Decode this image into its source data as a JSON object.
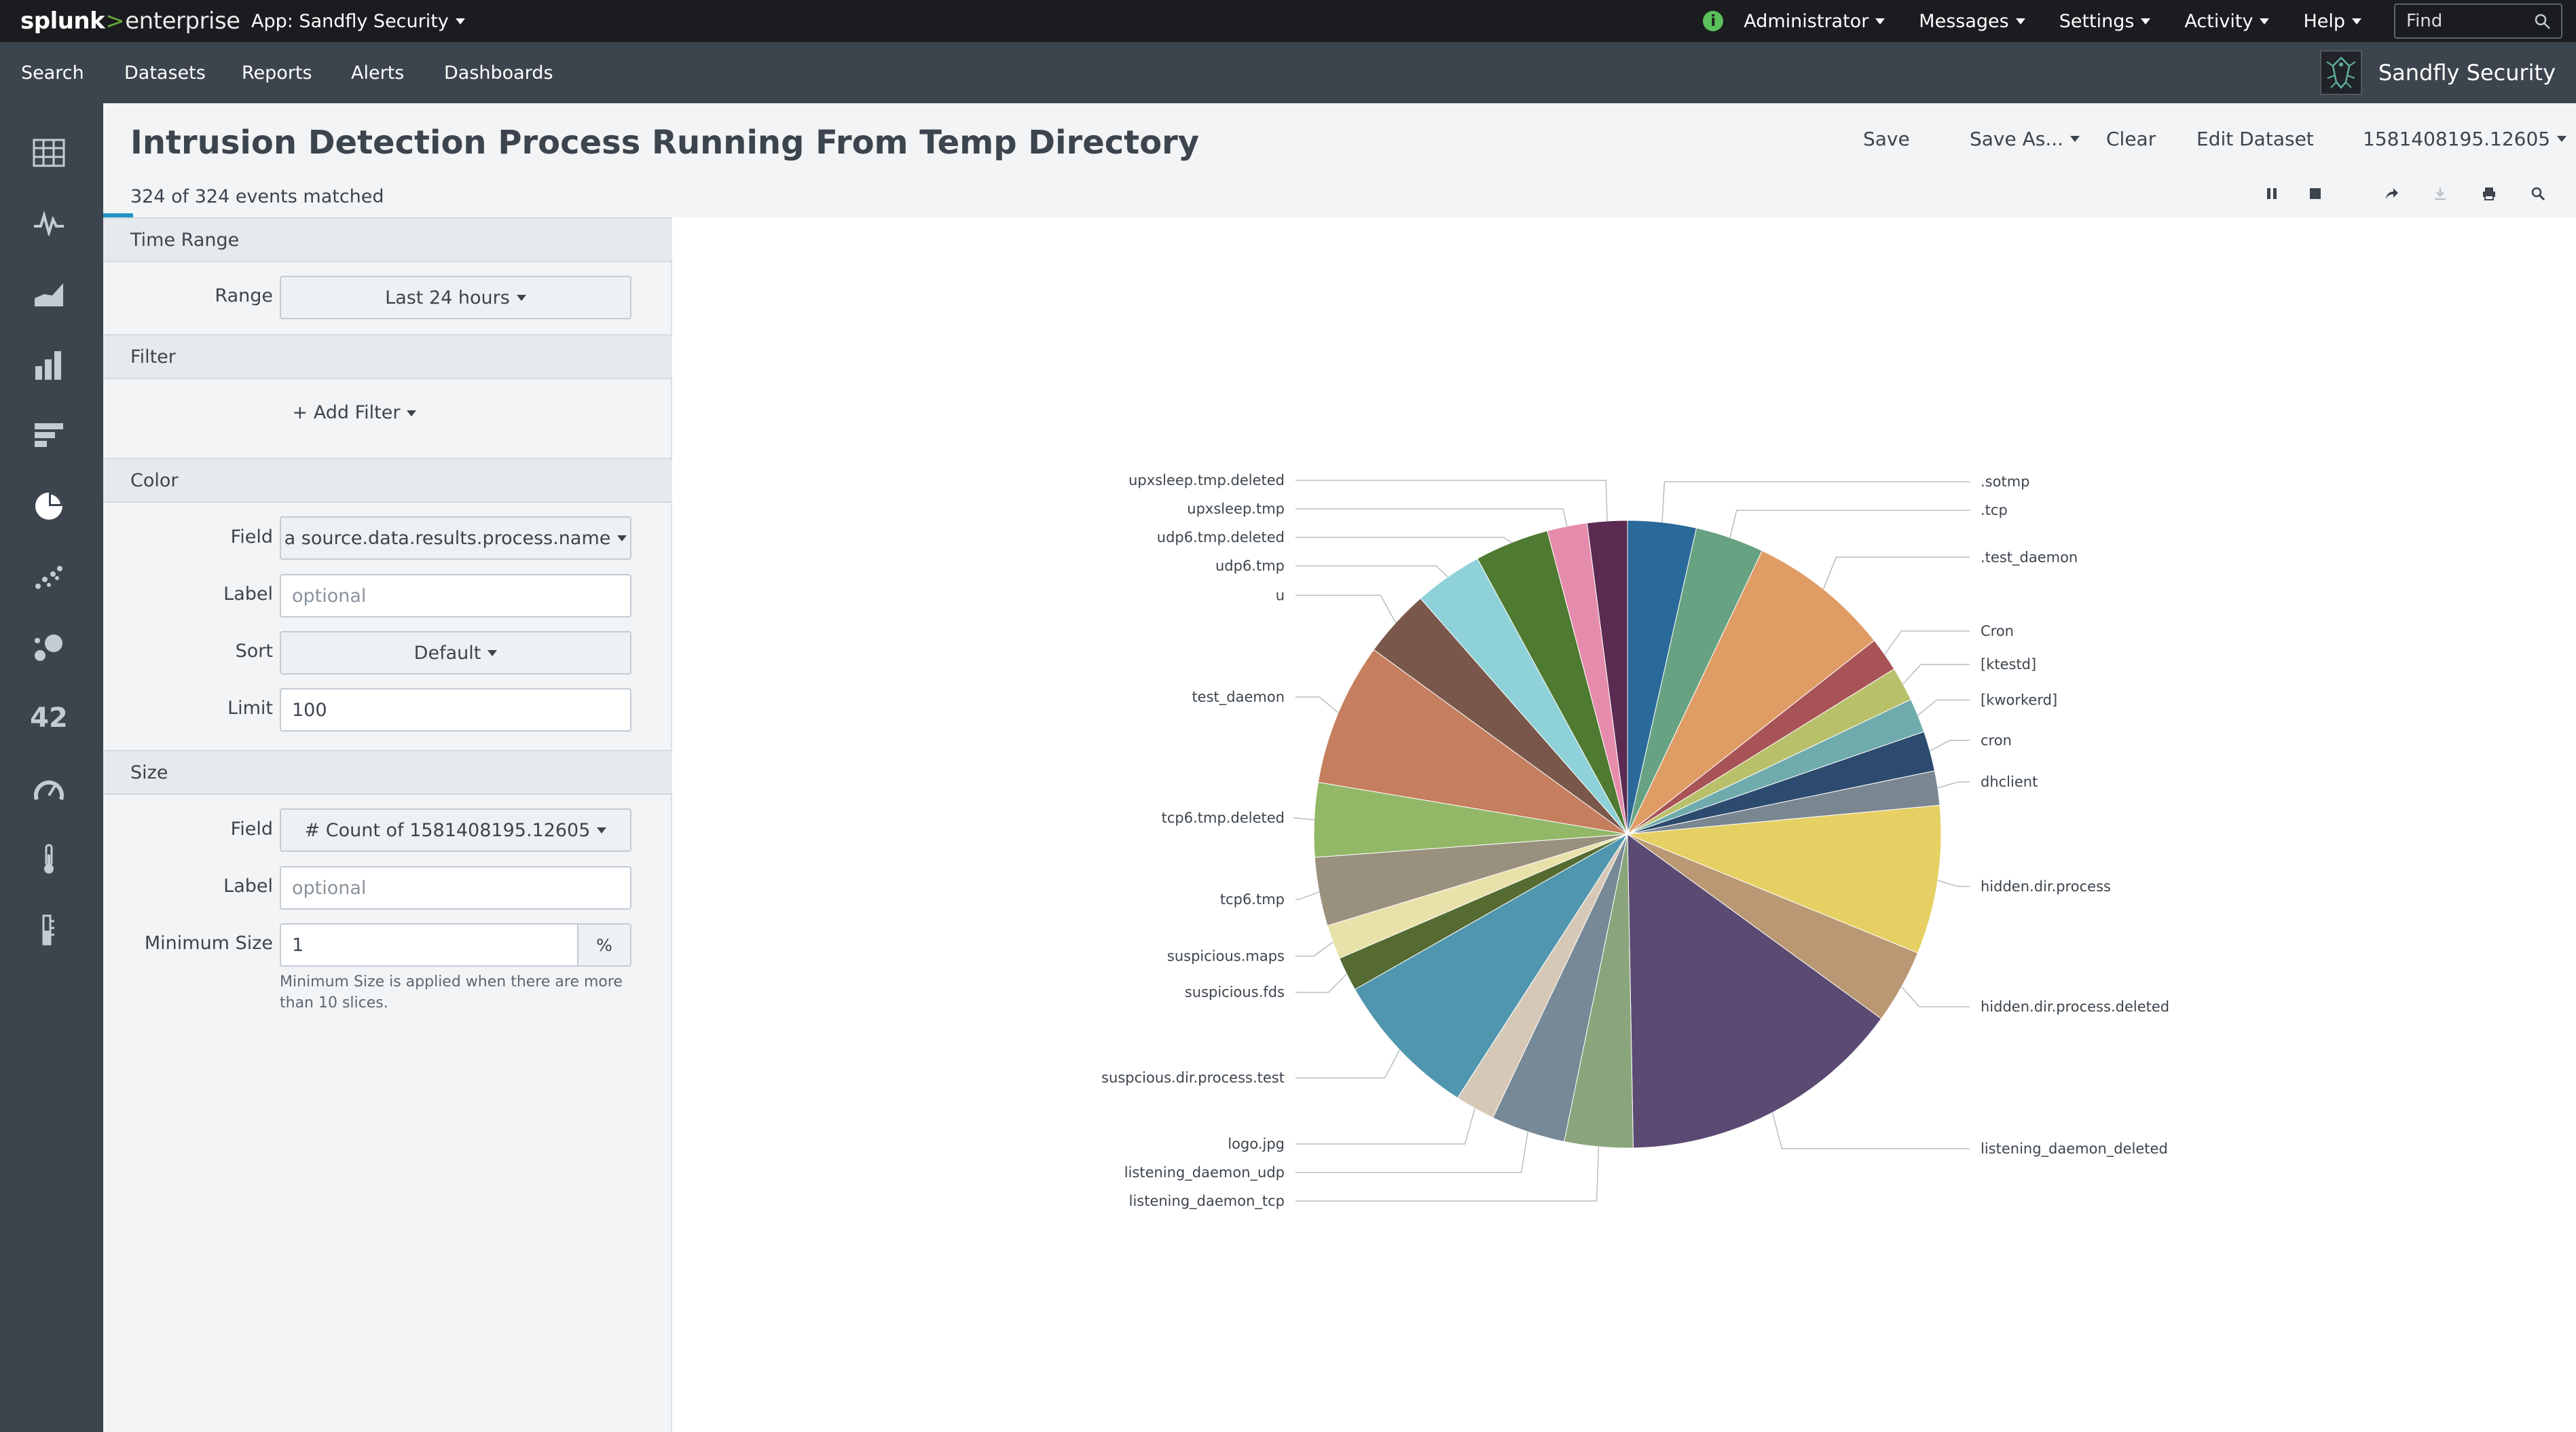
{
  "topbar": {
    "logo_splunk": "splunk",
    "logo_gt": ">",
    "logo_enterprise": "enterprise",
    "app_menu": "App: Sandfly Security",
    "info_icon": "i",
    "user_menu": "Administrator",
    "messages_menu": "Messages",
    "settings_menu": "Settings",
    "activity_menu": "Activity",
    "help_menu": "Help",
    "find_placeholder": "Find"
  },
  "nav": {
    "items": [
      {
        "label": "Search"
      },
      {
        "label": "Datasets"
      },
      {
        "label": "Reports"
      },
      {
        "label": "Alerts"
      },
      {
        "label": "Dashboards"
      }
    ],
    "app_name": "Sandfly Security"
  },
  "header": {
    "title": "Intrusion Detection Process Running From Temp Directory",
    "events_matched": "324 of 324 events matched",
    "save": "Save",
    "save_as": "Save As...",
    "clear": "Clear",
    "edit_dataset": "Edit Dataset",
    "job_id": "1581408195.12605"
  },
  "panel": {
    "time_range": {
      "heading": "Time Range",
      "range_label": "Range",
      "range_value": "Last 24 hours"
    },
    "filter": {
      "heading": "Filter",
      "add_filter": "+ Add Filter"
    },
    "color": {
      "heading": "Color",
      "field_label": "Field",
      "field_value": "a source.data.results.process.name",
      "label_label": "Label",
      "label_placeholder": "optional",
      "sort_label": "Sort",
      "sort_value": "Default",
      "limit_label": "Limit",
      "limit_value": "100"
    },
    "size": {
      "heading": "Size",
      "field_label": "Field",
      "field_value": "# Count of 1581408195.12605",
      "label_label": "Label",
      "label_placeholder": "optional",
      "min_size_label": "Minimum Size",
      "min_size_value": "1",
      "min_size_unit": "%",
      "help_line1": "Minimum Size is applied when there are more",
      "help_line2": "than 10 slices."
    }
  },
  "chart_data": {
    "type": "pie",
    "slices": [
      {
        "label": ".sotmp",
        "value": 12,
        "color": "#2a6a9a"
      },
      {
        "label": ".tcp",
        "value": 12,
        "color": "#67a282"
      },
      {
        "label": ".test_daemon",
        "value": 25,
        "color": "#e09c65"
      },
      {
        "label": "Cron",
        "value": 6,
        "color": "#a85457"
      },
      {
        "label": "[ktestd]",
        "value": 6,
        "color": "#b9c06a"
      },
      {
        "label": "[kworkerd]",
        "value": 6,
        "color": "#6fabac"
      },
      {
        "label": "cron",
        "value": 7,
        "color": "#2d4b6e"
      },
      {
        "label": "dhclient",
        "value": 6,
        "color": "#7a8791"
      },
      {
        "label": "hidden.dir.process",
        "value": 26,
        "color": "#e6d063"
      },
      {
        "label": "hidden.dir.process.deleted",
        "value": 13,
        "color": "#b99873"
      },
      {
        "label": "listening_daemon_deleted",
        "value": 50,
        "color": "#5b4a72"
      },
      {
        "label": "listening_daemon_tcp",
        "value": 12,
        "color": "#8aa57b"
      },
      {
        "label": "listening_daemon_udp",
        "value": 13,
        "color": "#778896"
      },
      {
        "label": "logo.jpg",
        "value": 7,
        "color": "#d6c8b6"
      },
      {
        "label": "suspcious.dir.process.test",
        "value": 26,
        "color": "#4f96ae"
      },
      {
        "label": "suspicious.fds",
        "value": 6,
        "color": "#556b32"
      },
      {
        "label": "suspicious.maps",
        "value": 6,
        "color": "#e8e1a9"
      },
      {
        "label": "tcp6.tmp",
        "value": 12,
        "color": "#9a907e"
      },
      {
        "label": "tcp6.tmp.deleted",
        "value": 13,
        "color": "#92b867"
      },
      {
        "label": "test_daemon",
        "value": 25,
        "color": "#c57e5e"
      },
      {
        "label": "u",
        "value": 12,
        "color": "#79574b"
      },
      {
        "label": "udp6.tmp",
        "value": 12,
        "color": "#8ed1d8"
      },
      {
        "label": "udp6.tmp.deleted",
        "value": 13,
        "color": "#4f7a31"
      },
      {
        "label": "upxsleep.tmp",
        "value": 7,
        "color": "#e58cac"
      },
      {
        "label": "upxsleep.tmp.deleted",
        "value": 7,
        "color": "#5a2a50"
      }
    ]
  }
}
